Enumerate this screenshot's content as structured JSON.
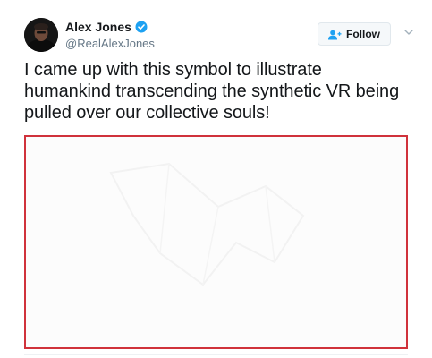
{
  "author": {
    "display_name": "Alex Jones",
    "screen_name": "@RealAlexJones",
    "verified": true,
    "verified_color": "#1da1f2"
  },
  "actions": {
    "follow_label": "Follow",
    "follow_icon": "add-user-icon",
    "more_icon": "chevron-down-icon"
  },
  "tweet": {
    "text": "I came up with this symbol to illustrate humankind transcending the synthetic VR being pulled over our collective souls!"
  },
  "media": {
    "border_color": "#d0323b",
    "background_color": "#fcfcfc"
  }
}
